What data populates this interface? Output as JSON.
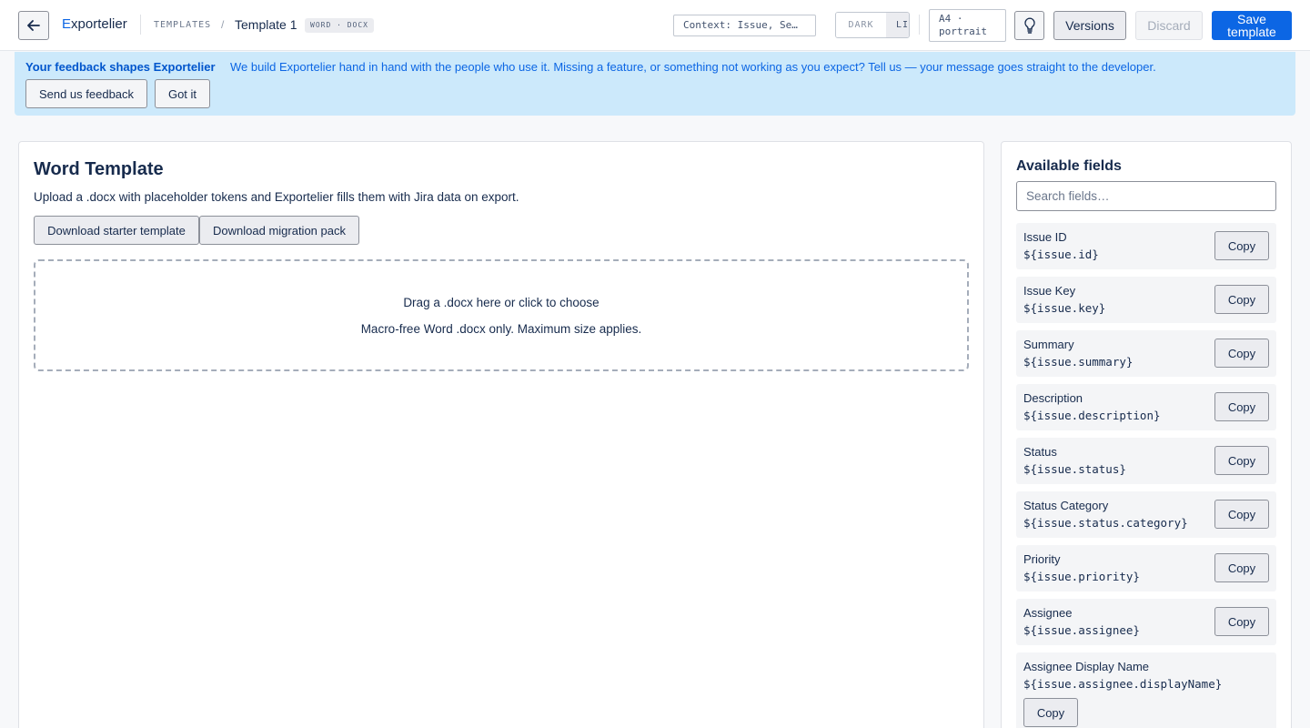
{
  "header": {
    "brand_initial": "E",
    "brand_rest": "xportelier",
    "breadcrumb_root": "TEMPLATES",
    "breadcrumb_sep": "/",
    "breadcrumb_current": "Template 1",
    "format_badge": "WORD · DOCX",
    "context": "Context: Issue, Se…",
    "theme_dark": "DARK",
    "theme_light": "LI",
    "page_size_line1": "A4 ·",
    "page_size_line2": "portrait",
    "versions_label": "Versions",
    "discard_label": "Discard",
    "save_line1": "Save",
    "save_line2": "template",
    "back_icon": "arrow-left-icon",
    "tip_icon": "lightbulb-icon",
    "accent_color": "#0c66e4"
  },
  "banner": {
    "title": "Your feedback shapes Exportelier",
    "message": "We build Exportelier hand in hand with the people who use it. Missing a feature, or something not working as you expect? Tell us — your message goes straight to the developer.",
    "feedback_label": "Send us feedback",
    "dismiss_label": "Got it",
    "background": "#cce9fb"
  },
  "main": {
    "title": "Word Template",
    "description": "Upload a .docx with placeholder tokens and Exportelier fills them with Jira data on export.",
    "download_starter": "Download starter template",
    "download_migration": "Download migration pack",
    "dropzone_line1": "Drag a .docx here or click to choose",
    "dropzone_line2": "Macro-free Word .docx only. Maximum size applies."
  },
  "sidebar": {
    "title": "Available fields",
    "search_placeholder": "Search fields…",
    "copy_label": "Copy",
    "fields": [
      {
        "label": "Issue ID",
        "token": "${issue.id}"
      },
      {
        "label": "Issue Key",
        "token": "${issue.key}"
      },
      {
        "label": "Summary",
        "token": "${issue.summary}"
      },
      {
        "label": "Description",
        "token": "${issue.description}"
      },
      {
        "label": "Status",
        "token": "${issue.status}"
      },
      {
        "label": "Status Category",
        "token": "${issue.status.category}"
      },
      {
        "label": "Priority",
        "token": "${issue.priority}"
      },
      {
        "label": "Assignee",
        "token": "${issue.assignee}"
      },
      {
        "label": "Assignee Display Name",
        "token": "${issue.assignee.displayName}"
      }
    ]
  }
}
